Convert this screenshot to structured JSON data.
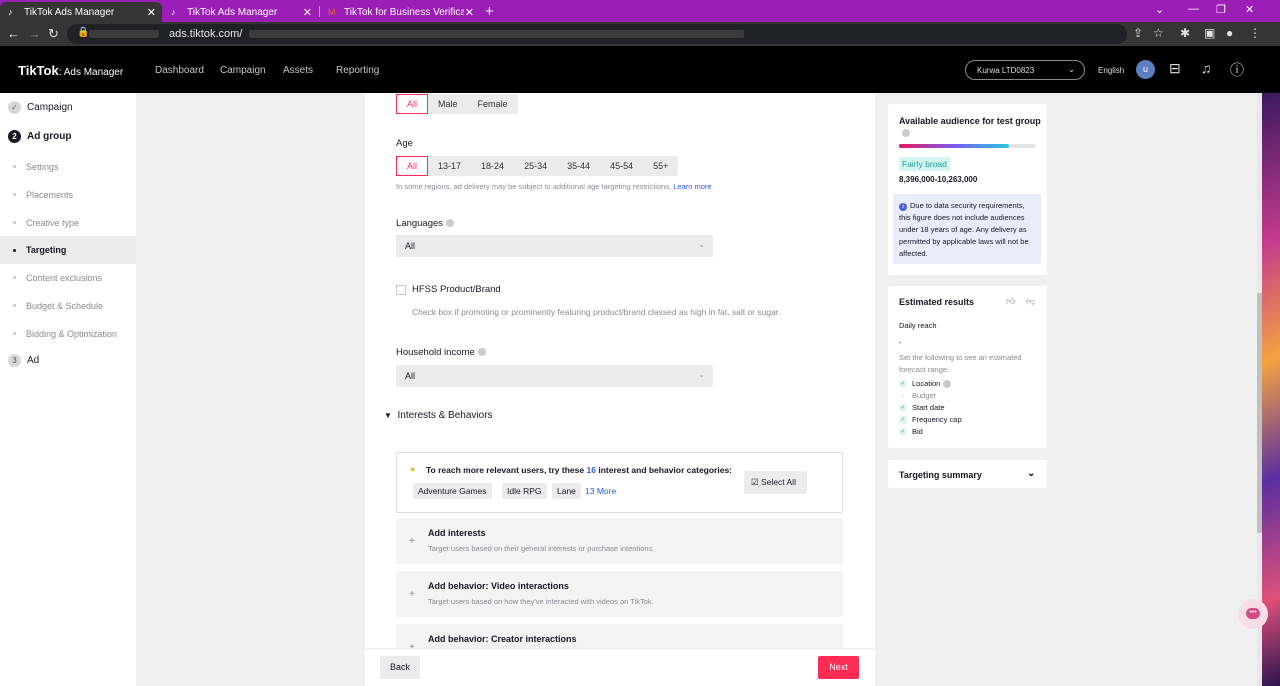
{
  "browser": {
    "tabs": [
      {
        "title": "TikTok Ads Manager",
        "active": true
      },
      {
        "title": "TikTok Ads Manager",
        "active": false
      },
      {
        "title": "TikTok for Business Verification C",
        "active": false
      }
    ],
    "url": "ads.tiktok.com/"
  },
  "header": {
    "logo": "TikTok",
    "logo_sub": ": Ads Manager",
    "nav": [
      "Dashboard",
      "Campaign",
      "Assets",
      "Reporting"
    ],
    "account": "Kurwa LTD0823",
    "language": "English",
    "avatar_letter": "u"
  },
  "sidebar": {
    "steps": [
      {
        "number": "✓",
        "label": "Campaign"
      },
      {
        "number": "2",
        "label": "Ad group"
      },
      {
        "number": "3",
        "label": "Ad"
      }
    ],
    "items": [
      {
        "label": "Settings"
      },
      {
        "label": "Placements"
      },
      {
        "label": "Creative type"
      },
      {
        "label": "Targeting"
      },
      {
        "label": "Content exclusions"
      },
      {
        "label": "Budget & Schedule"
      },
      {
        "label": "Bidding & Optimization"
      }
    ]
  },
  "form": {
    "gender_options": [
      "All",
      "Male",
      "Female"
    ],
    "age_label": "Age",
    "age_options": [
      "All",
      "13-17",
      "18-24",
      "25-34",
      "35-44",
      "45-54",
      "55+"
    ],
    "age_hint": "In some regions, ad delivery may be subject to additional age targeting restrictions.",
    "age_hint_link": "Learn more",
    "languages_label": "Languages",
    "languages_value": "All",
    "hfss_label": "HFSS Product/Brand",
    "hfss_hint": "Check box if promoting or prominently featuring product/brand classed as high in fat, salt or sugar.",
    "household_label": "Household income",
    "household_value": "All",
    "interests_section": "Interests & Behaviors",
    "suggestion_prefix": "To reach more relevant users, try these",
    "suggestion_count": "16",
    "suggestion_suffix": "interest and behavior categories:",
    "chips": [
      "Adventure Games",
      "Idle RPG",
      "Lane"
    ],
    "more_link": "13 More",
    "select_all": "Select All",
    "cards": [
      {
        "title": "Add interests",
        "desc": "Target users based on their general interests or purchase intentions."
      },
      {
        "title": "Add behavior: Video interactions",
        "desc": "Target users based on how they've interacted with videos on TikTok."
      },
      {
        "title": "Add behavior: Creator interactions",
        "desc": ""
      }
    ],
    "back": "Back",
    "next": "Next"
  },
  "audience": {
    "title": "Available audience for test group",
    "level_fraction": 0.8,
    "badge": "Fairly broad",
    "range": "8,396,000-10,263,000",
    "notice": "Due to data security requirements, this figure does not include audiences under 18 years of age. Any delivery as permitted by applicable laws will not be affected."
  },
  "estimated": {
    "title": "Estimated results",
    "daily_reach_label": "Daily reach",
    "daily_reach_value": "-",
    "hint": "Set the following to see an estimated forecast range:",
    "checklist": [
      {
        "label": "Location",
        "done": true
      },
      {
        "label": "Budget",
        "done": false
      },
      {
        "label": "Start date",
        "done": true
      },
      {
        "label": "Frequency cap",
        "done": true
      },
      {
        "label": "Bid",
        "done": true
      }
    ]
  },
  "summary": {
    "title": "Targeting summary"
  }
}
